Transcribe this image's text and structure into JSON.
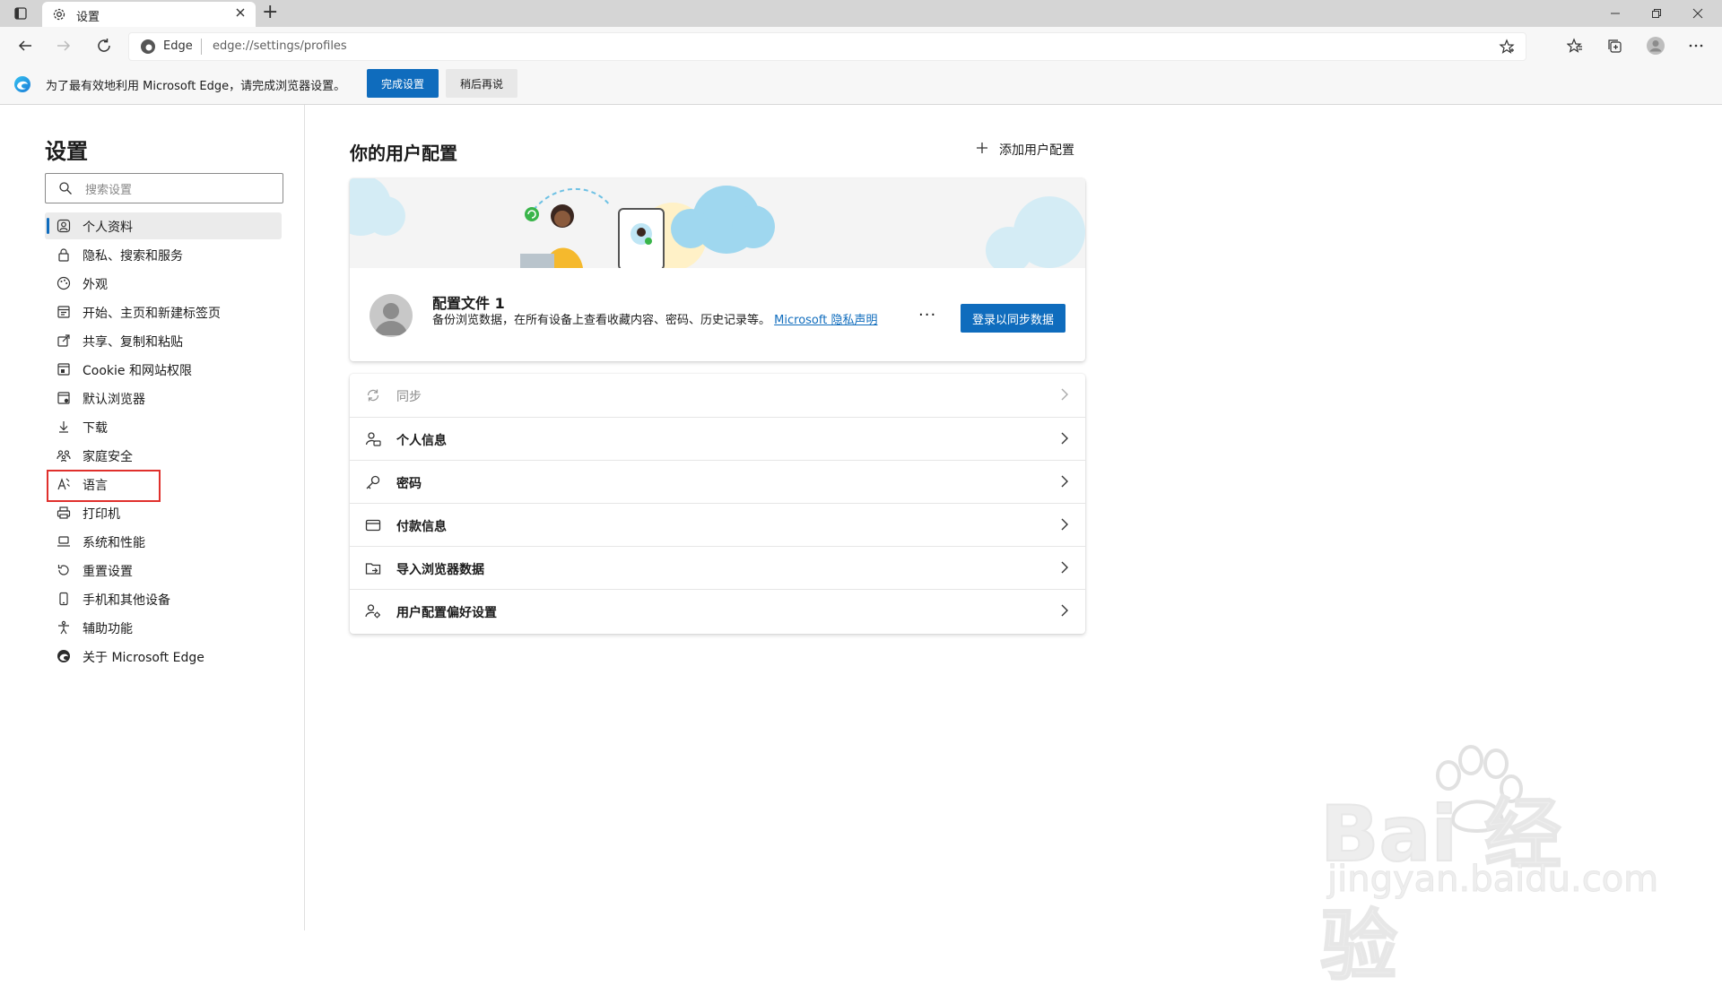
{
  "window": {
    "tab_title": "设置",
    "new_tab_symbol": "+",
    "address": {
      "site_label": "Edge",
      "url": "edge://settings/profiles"
    }
  },
  "infobar": {
    "message": "为了最有效地利用 Microsoft Edge，请完成浏览器设置。",
    "primary_button": "完成设置",
    "secondary_button": "稍后再说"
  },
  "sidebar": {
    "title": "设置",
    "search_placeholder": "搜索设置",
    "items": [
      {
        "label": "个人资料",
        "icon": "profile-icon"
      },
      {
        "label": "隐私、搜索和服务",
        "icon": "lock-icon"
      },
      {
        "label": "外观",
        "icon": "appearance-icon"
      },
      {
        "label": "开始、主页和新建标签页",
        "icon": "home-icon"
      },
      {
        "label": "共享、复制和粘贴",
        "icon": "share-icon"
      },
      {
        "label": "Cookie 和网站权限",
        "icon": "cookie-icon"
      },
      {
        "label": "默认浏览器",
        "icon": "browser-icon"
      },
      {
        "label": "下载",
        "icon": "download-icon"
      },
      {
        "label": "家庭安全",
        "icon": "family-icon"
      },
      {
        "label": "语言",
        "icon": "language-icon"
      },
      {
        "label": "打印机",
        "icon": "printer-icon"
      },
      {
        "label": "系统和性能",
        "icon": "laptop-icon"
      },
      {
        "label": "重置设置",
        "icon": "reset-icon"
      },
      {
        "label": "手机和其他设备",
        "icon": "phone-icon"
      },
      {
        "label": "辅助功能",
        "icon": "accessibility-icon"
      },
      {
        "label": "关于 Microsoft Edge",
        "icon": "edge-icon"
      }
    ]
  },
  "main": {
    "title": "你的用户配置",
    "add_profile": "添加用户配置",
    "profile": {
      "name": "配置文件 1",
      "description": "备份浏览数据，在所有设备上查看收藏内容、密码、历史记录等。",
      "privacy_link": "Microsoft 隐私声明",
      "more": "···",
      "sign_in_button": "登录以同步数据"
    },
    "rows": [
      {
        "label": "同步",
        "icon": "sync-icon",
        "disabled": true
      },
      {
        "label": "个人信息",
        "icon": "person-info-icon"
      },
      {
        "label": "密码",
        "icon": "key-icon"
      },
      {
        "label": "付款信息",
        "icon": "card-icon"
      },
      {
        "label": "导入浏览器数据",
        "icon": "import-icon"
      },
      {
        "label": "用户配置偏好设置",
        "icon": "profile-prefs-icon"
      }
    ]
  },
  "watermark": {
    "main": "Bai 经验",
    "sub": "jingyan.baidu.com"
  },
  "colors": {
    "accent": "#0f6cbd",
    "highlight_box": "#e0302c"
  }
}
